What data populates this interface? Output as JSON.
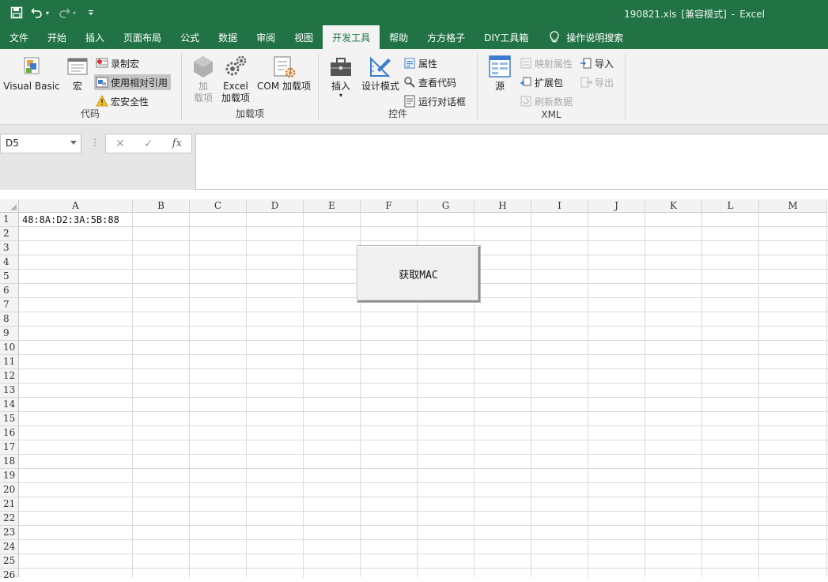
{
  "titlebar": {
    "filename": "190821.xls",
    "mode": "[兼容模式]",
    "dash": "-",
    "app": "Excel",
    "bg_color": "#217346"
  },
  "qat": {
    "icons": [
      "save-icon",
      "undo-icon",
      "redo-icon",
      "customize-caret-icon"
    ]
  },
  "tabs": [
    {
      "label": "文件"
    },
    {
      "label": "开始"
    },
    {
      "label": "插入"
    },
    {
      "label": "页面布局"
    },
    {
      "label": "公式"
    },
    {
      "label": "数据"
    },
    {
      "label": "审阅"
    },
    {
      "label": "视图"
    },
    {
      "label": "开发工具",
      "active": true
    },
    {
      "label": "帮助"
    },
    {
      "label": "方方格子"
    },
    {
      "label": "DIY工具箱"
    },
    {
      "label": "操作说明搜索"
    }
  ],
  "ribbon": {
    "code": {
      "label": "代码",
      "visual_basic": "Visual Basic",
      "macros": "宏",
      "record_macro": "录制宏",
      "relative_ref": "使用相对引用",
      "macro_security": "宏安全性"
    },
    "addins": {
      "label": "加载项",
      "addins_line1": "加",
      "addins_line2": "载项",
      "excel_line1": "Excel",
      "excel_line2": "加载项",
      "com": "COM 加载项"
    },
    "controls": {
      "label": "控件",
      "insert": "插入",
      "design_mode": "设计模式",
      "properties": "属性",
      "view_code": "查看代码",
      "run_dialog": "运行对话框"
    },
    "xml": {
      "label": "XML",
      "source": "源",
      "map_props": "映射属性",
      "expansion": "扩展包",
      "refresh": "刷新数据",
      "import": "导入",
      "export": "导出"
    }
  },
  "formula_bar": {
    "name_box": "D5",
    "cancel": "✕",
    "enter": "✓",
    "fx": "fx",
    "formula": ""
  },
  "grid": {
    "columns": [
      "A",
      "B",
      "C",
      "D",
      "E",
      "F",
      "G",
      "H",
      "I",
      "J",
      "K",
      "L",
      "M"
    ],
    "rows": [
      "1",
      "2",
      "3",
      "4",
      "5",
      "6",
      "7",
      "8",
      "9",
      "10",
      "11",
      "12",
      "13",
      "14",
      "15",
      "16",
      "17",
      "18",
      "19",
      "20",
      "21",
      "22",
      "23",
      "24",
      "25",
      "26"
    ],
    "a1": "48:8A:D2:3A:5B:88"
  },
  "form_button": {
    "label": "获取MAC"
  }
}
